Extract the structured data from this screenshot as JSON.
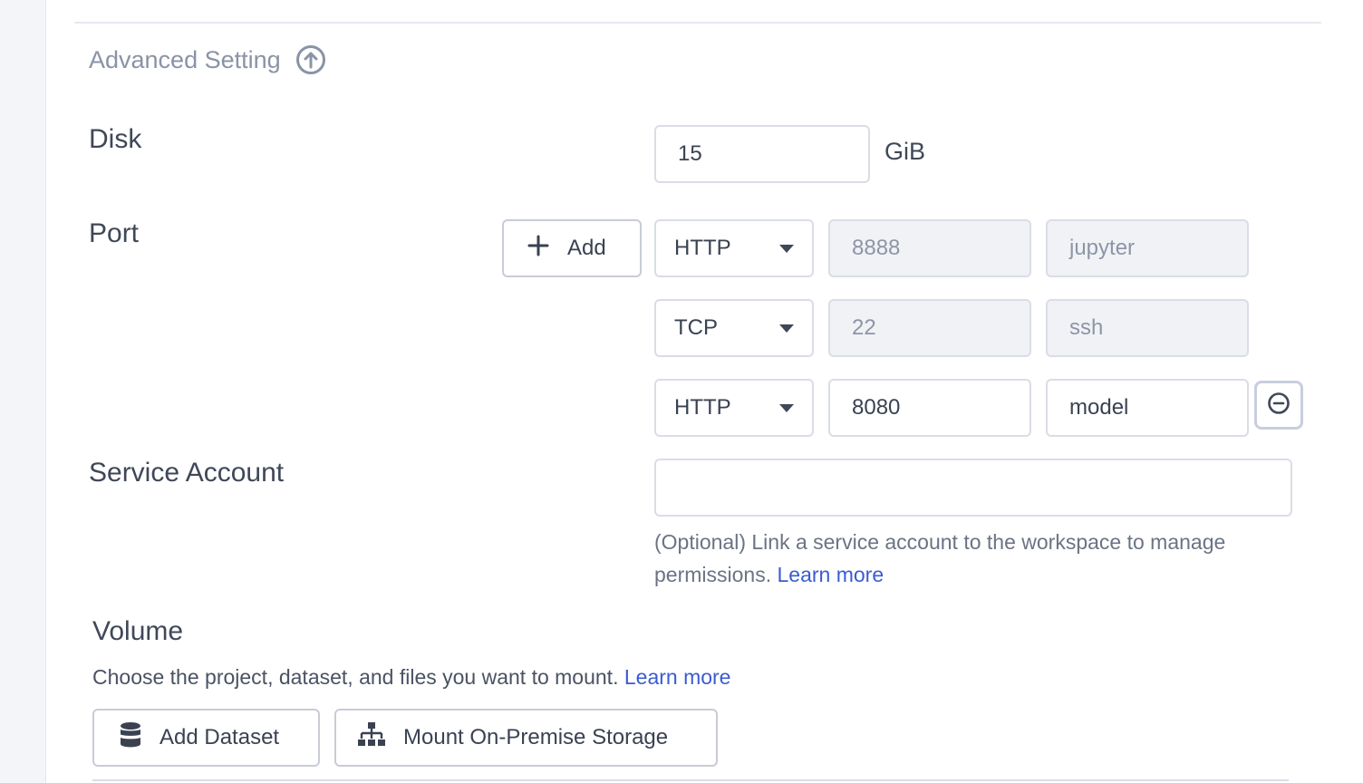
{
  "advanced": {
    "title": "Advanced Setting",
    "toggle_icon": "arrow-up-circle-icon"
  },
  "disk": {
    "label": "Disk",
    "value": "15",
    "unit": "GiB"
  },
  "port": {
    "label": "Port",
    "add_label": "Add",
    "rows": [
      {
        "protocol": "HTTP",
        "port": "8888",
        "name": "jupyter",
        "editable": false
      },
      {
        "protocol": "TCP",
        "port": "22",
        "name": "ssh",
        "editable": false
      },
      {
        "protocol": "HTTP",
        "port": "8080",
        "name": "model",
        "editable": true
      }
    ]
  },
  "service_account": {
    "label": "Service Account",
    "value": "",
    "help_text": "(Optional) Link a service account to the workspace to manage permissions.",
    "help_link": "Learn more"
  },
  "volume": {
    "title": "Volume",
    "description": "Choose the project, dataset, and files you want to mount.",
    "link": "Learn more",
    "add_dataset_label": "Add Dataset",
    "mount_label": "Mount On-Premise Storage"
  },
  "colors": {
    "accent_link": "#3b5bd3",
    "muted_text": "#8a93a6",
    "disabled_bg": "#f1f2f6"
  }
}
